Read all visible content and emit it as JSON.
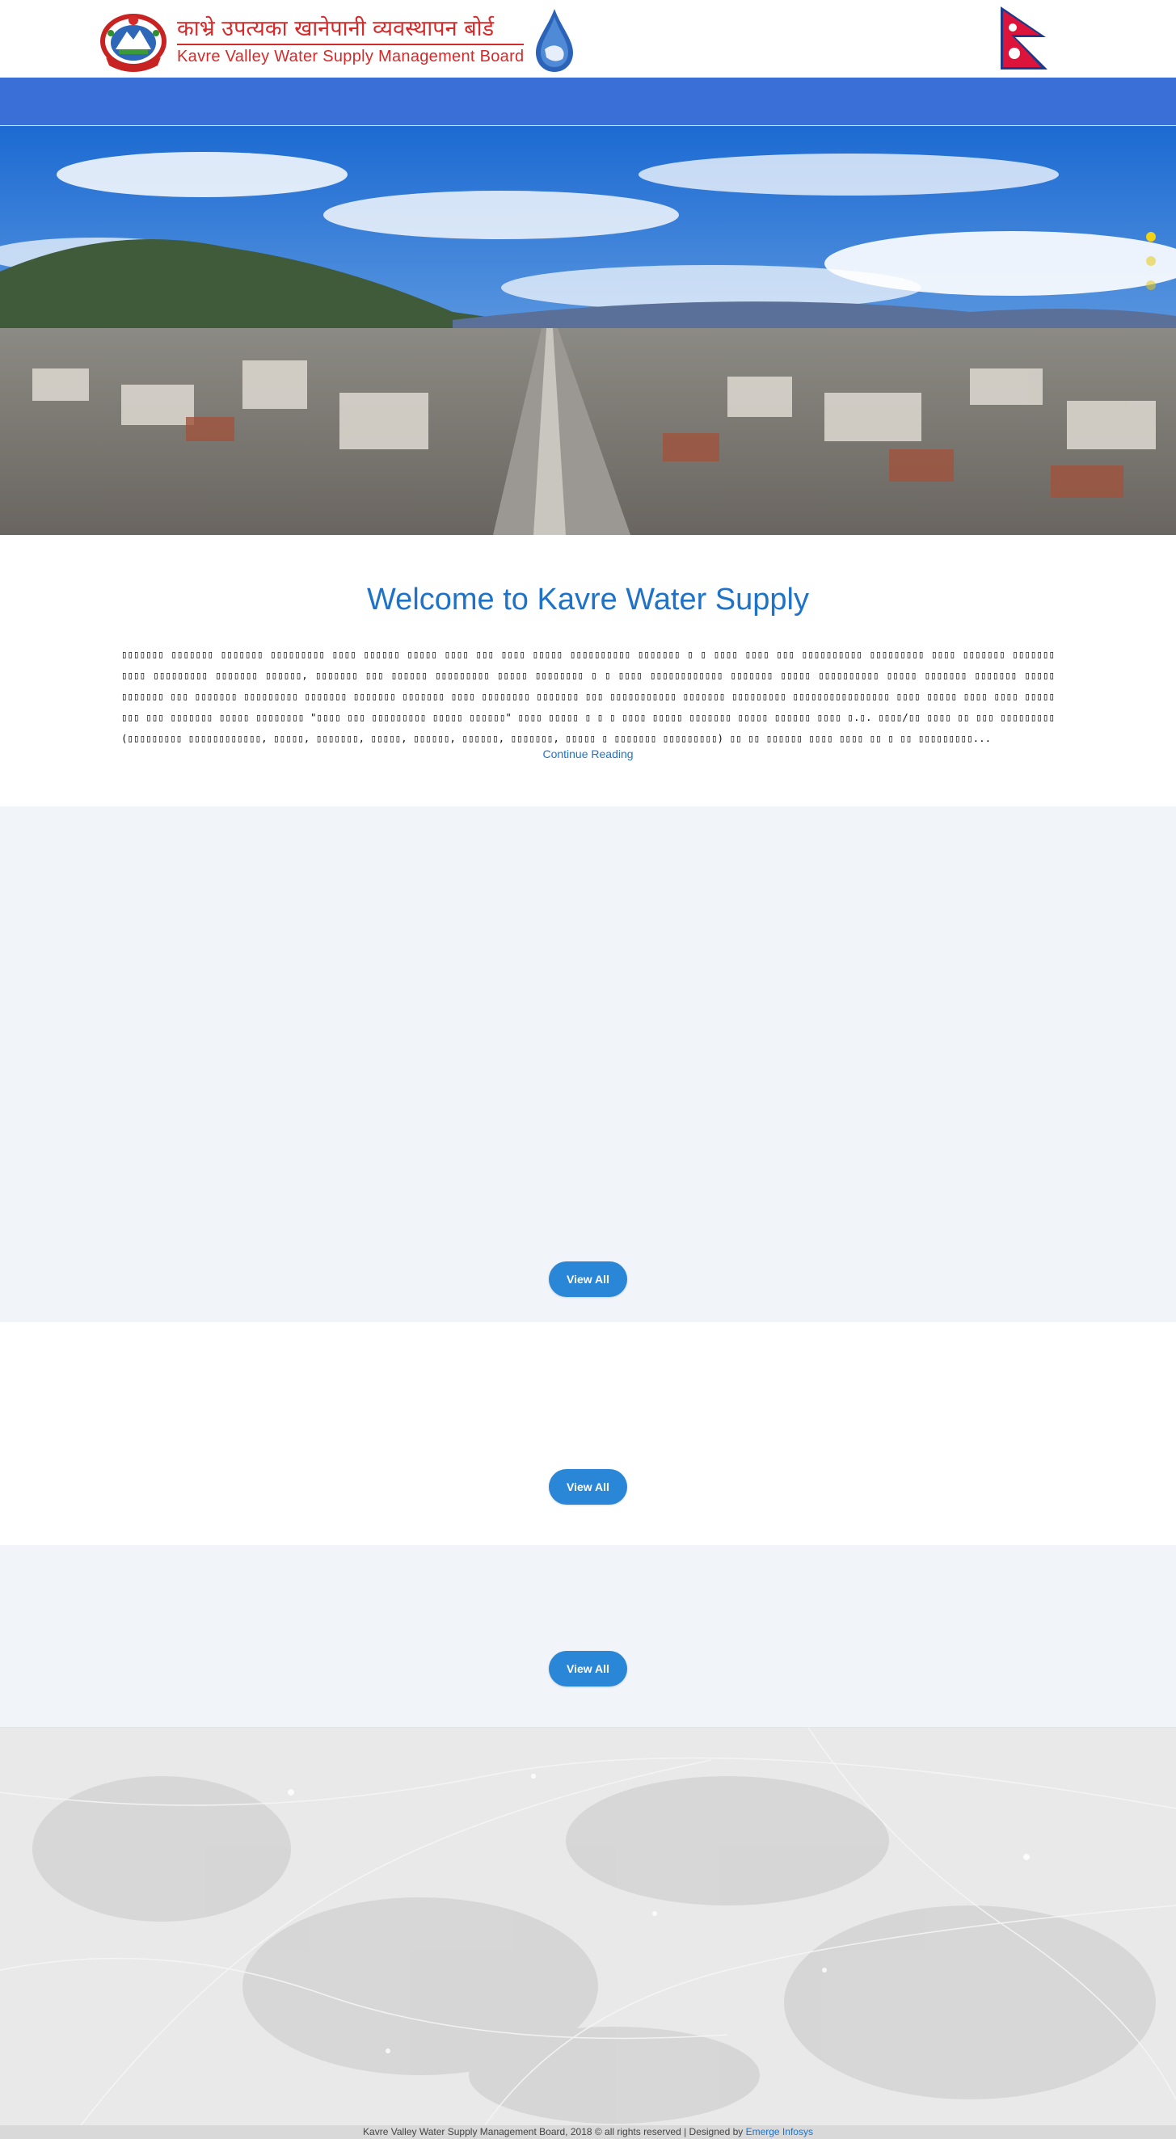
{
  "header": {
    "title_np": "काभ्रे उपत्यका खानेपानी व्यवस्थापन बोर्ड",
    "title_en": "Kavre Valley Water Supply Management Board"
  },
  "hero": {
    "slide_count": 3,
    "active_slide": 1
  },
  "welcome": {
    "heading": "Welcome to Kavre Water Supply",
    "paragraph": "▯▯▯▯▯▯▯ ▯▯▯▯▯▯▯ ▯▯▯▯▯▯▯ ▯▯▯▯▯▯▯▯▯ ▯▯▯▯ ▯▯▯▯▯▯ ▯▯▯▯▯ ▯▯▯▯ ▯▯▯ ▯▯▯▯ ▯▯▯▯▯ ▯▯▯▯▯▯▯▯▯▯ ▯▯▯▯▯▯▯ ▯ ▯ ▯▯▯▯ ▯▯▯▯ ▯▯▯ ▯▯▯▯▯▯▯▯▯▯ ▯▯▯▯▯▯▯▯▯ ▯▯▯▯ ▯▯▯▯▯▯▯ ▯▯▯▯▯▯▯ ▯▯▯▯ ▯▯▯▯▯▯▯▯▯ ▯▯▯▯▯▯▯ ▯▯▯▯▯▯, ▯▯▯▯▯▯▯ ▯▯▯ ▯▯▯▯▯▯ ▯▯▯▯▯▯▯▯▯ ▯▯▯▯▯ ▯▯▯▯▯▯▯▯ ▯ ▯ ▯▯▯▯ ▯▯▯▯▯▯▯▯▯▯▯▯ ▯▯▯▯▯▯▯ ▯▯▯▯▯ ▯▯▯▯▯▯▯▯▯▯ ▯▯▯▯▯ ▯▯▯▯▯▯▯ ▯▯▯▯▯▯▯ ▯▯▯▯▯ ▯▯▯▯▯▯▯ ▯▯▯ ▯▯▯▯▯▯▯ ▯▯▯▯▯▯▯▯▯ ▯▯▯▯▯▯▯ ▯▯▯▯▯▯▯ ▯▯▯▯▯▯▯ ▯▯▯▯ ▯▯▯▯▯▯▯▯ ▯▯▯▯▯▯▯ ▯▯▯ ▯▯▯▯▯▯▯▯▯▯▯ ▯▯▯▯▯▯▯ ▯▯▯▯▯▯▯▯▯ ▯▯▯▯▯▯▯▯▯▯▯▯▯▯▯▯ ▯▯▯▯ ▯▯▯▯▯ ▯▯▯▯ ▯▯▯▯ ▯▯▯▯▯ ▯▯▯ ▯▯▯ ▯▯▯▯▯▯▯ ▯▯▯▯▯ ▯▯▯▯▯▯▯▯ \"▯▯▯▯ ▯▯▯ ▯▯▯▯▯▯▯▯▯ ▯▯▯▯▯ ▯▯▯▯▯▯\" ▯▯▯▯ ▯▯▯▯▯ ▯ ▯ ▯ ▯▯▯▯ ▯▯▯▯▯ ▯▯▯▯▯▯▯ ▯▯▯▯▯ ▯▯▯▯▯▯ ▯▯▯▯ ▯.▯. ▯▯▯▯/▯▯ ▯▯▯▯ ▯▯ ▯▯▯ ▯▯▯▯▯▯▯▯▯ (▯▯▯▯▯▯▯▯▯ ▯▯▯▯▯▯▯▯▯▯▯▯, ▯▯▯▯▯, ▯▯▯▯▯▯▯, ▯▯▯▯▯, ▯▯▯▯▯▯, ▯▯▯▯▯▯, ▯▯▯▯▯▯▯, ▯▯▯▯▯ ▯ ▯▯▯▯▯▯▯ ▯▯▯▯▯▯▯▯▯) ▯▯ ▯▯ ▯▯▯▯▯▯ ▯▯▯▯ ▯▯▯▯ ▯▯ ▯ ▯▯ ▯▯▯▯▯▯▯▯▯...",
    "continue_label": "Continue Reading"
  },
  "sections": {
    "first_view_all": "View All",
    "second_view_all": "View All",
    "third_view_all": "View All"
  },
  "footer": {
    "copyright": "Kavre Valley Water Supply Management Board, 2018 © all rights reserved | Designed by ",
    "designer": "Emerge Infosys"
  },
  "colors": {
    "navbar": "#3b6fd8",
    "brand_red": "#d42a2a",
    "link_blue": "#1e73c8",
    "button_blue": "#2a86d6",
    "slider_dot": "#f1d016"
  },
  "icons": {
    "emblem": "nepal-emblem-icon",
    "drop": "water-drop-icon",
    "flag": "nepal-flag-icon"
  }
}
